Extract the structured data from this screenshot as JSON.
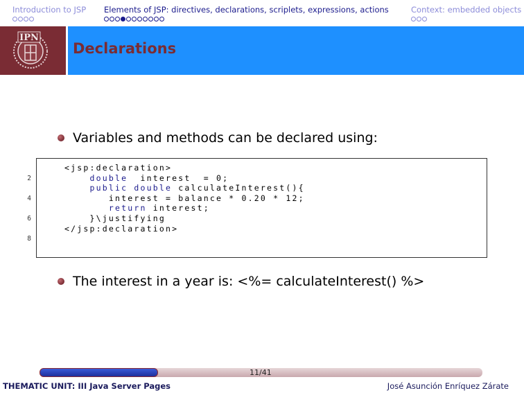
{
  "nav": {
    "sections": [
      {
        "label": "Introduction to JSP",
        "dots": 4,
        "current_dot": -1,
        "active": false
      },
      {
        "label": "Elements of JSP: directives, declarations, scriplets, expressions, actions",
        "dots": 11,
        "current_dot": 3,
        "active": true
      },
      {
        "label": "Context: embedded objects",
        "dots": 3,
        "current_dot": -1,
        "active": false
      }
    ]
  },
  "frame": {
    "title": "Declarations",
    "logo_text": "IPN"
  },
  "bullets": [
    {
      "text": "Variables and methods can be declared using:"
    },
    {
      "text": "The interest in a year is: <%= calculateInterest() %>"
    }
  ],
  "code": {
    "lines": [
      {
        "number": "",
        "text": "<jsp:declaration>"
      },
      {
        "number": "2",
        "text": "    double  interest  = 0;"
      },
      {
        "number": "",
        "text": "    public double calculateInterest(){"
      },
      {
        "number": "4",
        "text": "       interest = balance * 0.20 * 12;"
      },
      {
        "number": "",
        "text": "       return interest;"
      },
      {
        "number": "6",
        "text": "    }\\justifying"
      },
      {
        "number": "",
        "text": "</jsp:declaration>"
      },
      {
        "number": "8",
        "text": ""
      }
    ]
  },
  "footer": {
    "left": "THEMATIC UNIT: III Java Server Pages",
    "right": "José Asunción Enríquez Zárate",
    "page_label": "11/41",
    "progress": 0.268
  },
  "colors": {
    "header_blue": "#1e90ff",
    "maroon": "#7a2c34",
    "nav_active": "#1a1a8c",
    "nav_inactive": "#8c8cd9"
  }
}
